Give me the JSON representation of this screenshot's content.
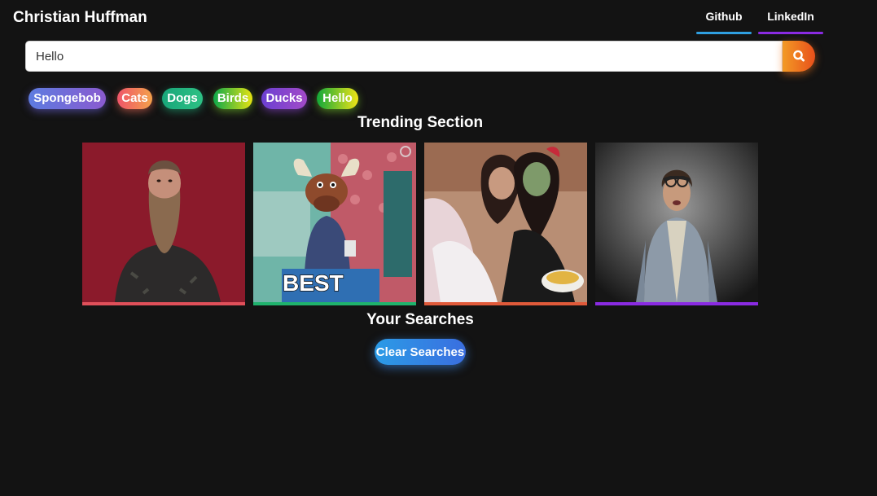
{
  "header": {
    "brand": "Christian Huffman",
    "links": [
      {
        "label": "Github",
        "color": "#2f9fe0"
      },
      {
        "label": "LinkedIn",
        "color": "#8a2be2"
      }
    ]
  },
  "search": {
    "value": "Hello",
    "button_icon": "search-icon"
  },
  "tags": [
    {
      "label": "Spongebob",
      "gradient": [
        "#5d7ce0",
        "#8a5ad0"
      ]
    },
    {
      "label": "Cats",
      "gradient": [
        "#f0556a",
        "#f3a14a"
      ]
    },
    {
      "label": "Dogs",
      "gradient": [
        "#18a67a",
        "#2dc184"
      ]
    },
    {
      "label": "Birds",
      "gradient": [
        "#0ea84b",
        "#e6e312"
      ]
    },
    {
      "label": "Ducks",
      "gradient": [
        "#6b3fd2",
        "#a24ac8"
      ]
    },
    {
      "label": "Hello",
      "gradient": [
        "#12a83a",
        "#f0e417"
      ]
    }
  ],
  "trending": {
    "title": "Trending Section",
    "gifs": [
      {
        "subject": "bearded man on red background",
        "underline": "#e0505a"
      },
      {
        "subject": "moose puppet with BEST sign",
        "caption": "BEST",
        "underline": "#1fb36d"
      },
      {
        "subject": "two women relaxing with popcorn",
        "underline": "#e05a3a"
      },
      {
        "subject": "man in denim jacket on grey background",
        "underline": "#8a2be2"
      }
    ]
  },
  "searches": {
    "title": "Your Searches",
    "clear_label": "Clear Searches"
  }
}
